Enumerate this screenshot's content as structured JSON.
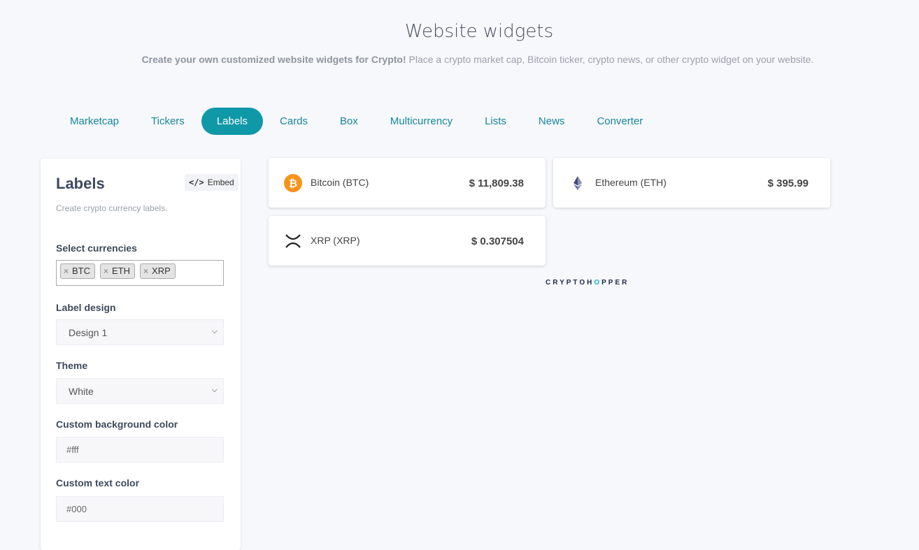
{
  "header": {
    "title": "Website widgets",
    "subtitle_bold": "Create your own customized website widgets for Crypto!",
    "subtitle_rest": "Place a crypto market cap, Bitcoin ticker, crypto news, or other crypto widget on your website."
  },
  "tabs": [
    {
      "label": "Marketcap",
      "active": false
    },
    {
      "label": "Tickers",
      "active": false
    },
    {
      "label": "Labels",
      "active": true
    },
    {
      "label": "Cards",
      "active": false
    },
    {
      "label": "Box",
      "active": false
    },
    {
      "label": "Multicurrency",
      "active": false
    },
    {
      "label": "Lists",
      "active": false
    },
    {
      "label": "News",
      "active": false
    },
    {
      "label": "Converter",
      "active": false
    }
  ],
  "panel": {
    "title": "Labels",
    "embed_label": "Embed",
    "description": "Create crypto currency labels.",
    "select_currencies_label": "Select currencies",
    "currencies": [
      "BTC",
      "ETH",
      "XRP"
    ],
    "label_design_label": "Label design",
    "label_design_value": "Design 1",
    "theme_label": "Theme",
    "theme_value": "White",
    "bg_color_label": "Custom background color",
    "bg_color_value": "#fff",
    "text_color_label": "Custom text color",
    "text_color_value": "#000"
  },
  "preview": {
    "cards": [
      {
        "name": "Bitcoin (BTC)",
        "price": "$ 11,809.38",
        "icon": "bitcoin-icon"
      },
      {
        "name": "Ethereum (ETH)",
        "price": "$ 395.99",
        "icon": "ethereum-icon"
      },
      {
        "name": "XRP (XRP)",
        "price": "$ 0.307504",
        "icon": "xrp-icon"
      }
    ],
    "brand_a": "CRYPTOH",
    "brand_o": "O",
    "brand_b": "PPER"
  },
  "colors": {
    "accent": "#0f98a8",
    "tab_text": "#15879a",
    "bitcoin": "#f7931a",
    "ethereum": "#627eea"
  }
}
